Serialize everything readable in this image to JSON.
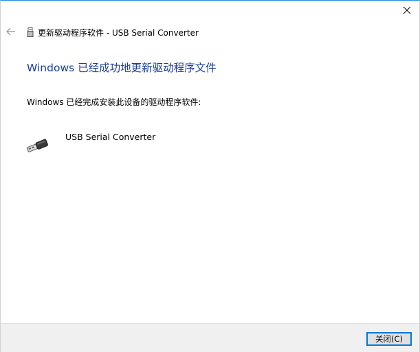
{
  "window": {
    "breadcrumb_title": "更新驱动程序软件 - USB Serial Converter",
    "heading": "Windows 已经成功地更新驱动程序文件",
    "message": "Windows 已经完成安装此设备的驱动程序软件:",
    "device_name": "USB Serial Converter",
    "close_button_label": "关闭(C)"
  },
  "icons": {
    "close": "close-icon",
    "back": "back-arrow-icon",
    "title": "usb-device-icon",
    "device": "usb-connector-icon"
  },
  "colors": {
    "heading": "#1a3f9c",
    "accent_border": "#1a8fd6",
    "footer_bg": "#f0f0f0",
    "button_focus": "#0078d7"
  }
}
